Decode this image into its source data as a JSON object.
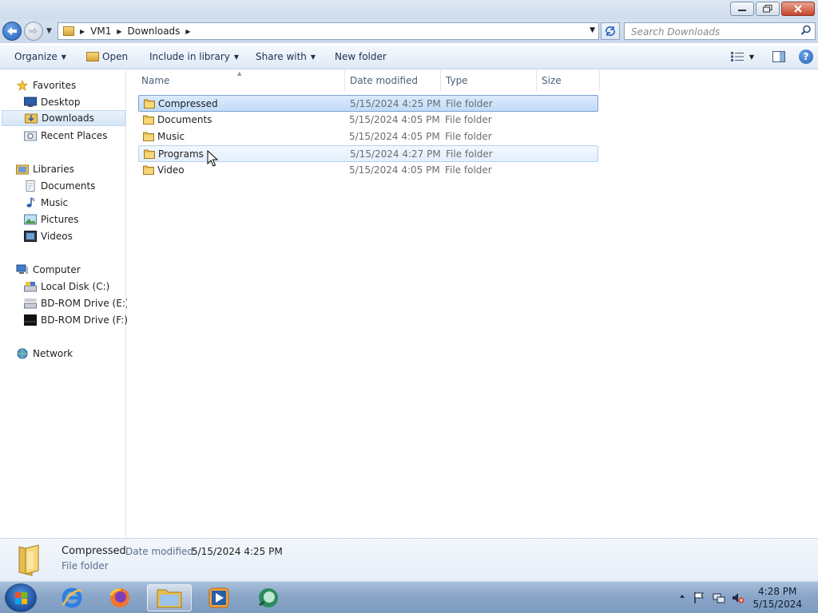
{
  "window": {
    "minimize": "▭",
    "maximize": "❐",
    "close": "✕"
  },
  "address": {
    "crumbs": [
      "VM1",
      "Downloads"
    ],
    "search_placeholder": "Search Downloads"
  },
  "commands": {
    "organize": "Organize",
    "open": "Open",
    "include_in_library": "Include in library",
    "share_with": "Share with",
    "new_folder": "New folder"
  },
  "nav": {
    "favorites": "Favorites",
    "desktop": "Desktop",
    "downloads": "Downloads",
    "recent_places": "Recent Places",
    "libraries": "Libraries",
    "documents": "Documents",
    "music": "Music",
    "pictures": "Pictures",
    "videos": "Videos",
    "computer": "Computer",
    "local_disk": "Local Disk (C:)",
    "bd_rom_e": "BD-ROM Drive (E:) T",
    "bd_rom_f": "BD-ROM Drive (F:) T",
    "network": "Network"
  },
  "columns": {
    "name": "Name",
    "date_modified": "Date modified",
    "type": "Type",
    "size": "Size"
  },
  "files": [
    {
      "name": "Compressed",
      "date": "5/15/2024 4:25 PM",
      "type": "File folder"
    },
    {
      "name": "Documents",
      "date": "5/15/2024 4:05 PM",
      "type": "File folder"
    },
    {
      "name": "Music",
      "date": "5/15/2024 4:05 PM",
      "type": "File folder"
    },
    {
      "name": "Programs",
      "date": "5/15/2024 4:27 PM",
      "type": "File folder"
    },
    {
      "name": "Video",
      "date": "5/15/2024 4:05 PM",
      "type": "File folder"
    }
  ],
  "details": {
    "name": "Compressed",
    "date_label": "Date modified:",
    "date_value": "5/15/2024 4:25 PM",
    "type": "File folder"
  },
  "taskbar": {
    "time": "4:28 PM",
    "date": "5/15/2024"
  },
  "icons": {
    "folder": "folder-icon",
    "start": "windows-start-icon",
    "ie": "internet-explorer-icon",
    "firefox": "firefox-icon",
    "explorer": "file-explorer-icon",
    "media": "media-player-icon",
    "app": "green-app-icon"
  }
}
